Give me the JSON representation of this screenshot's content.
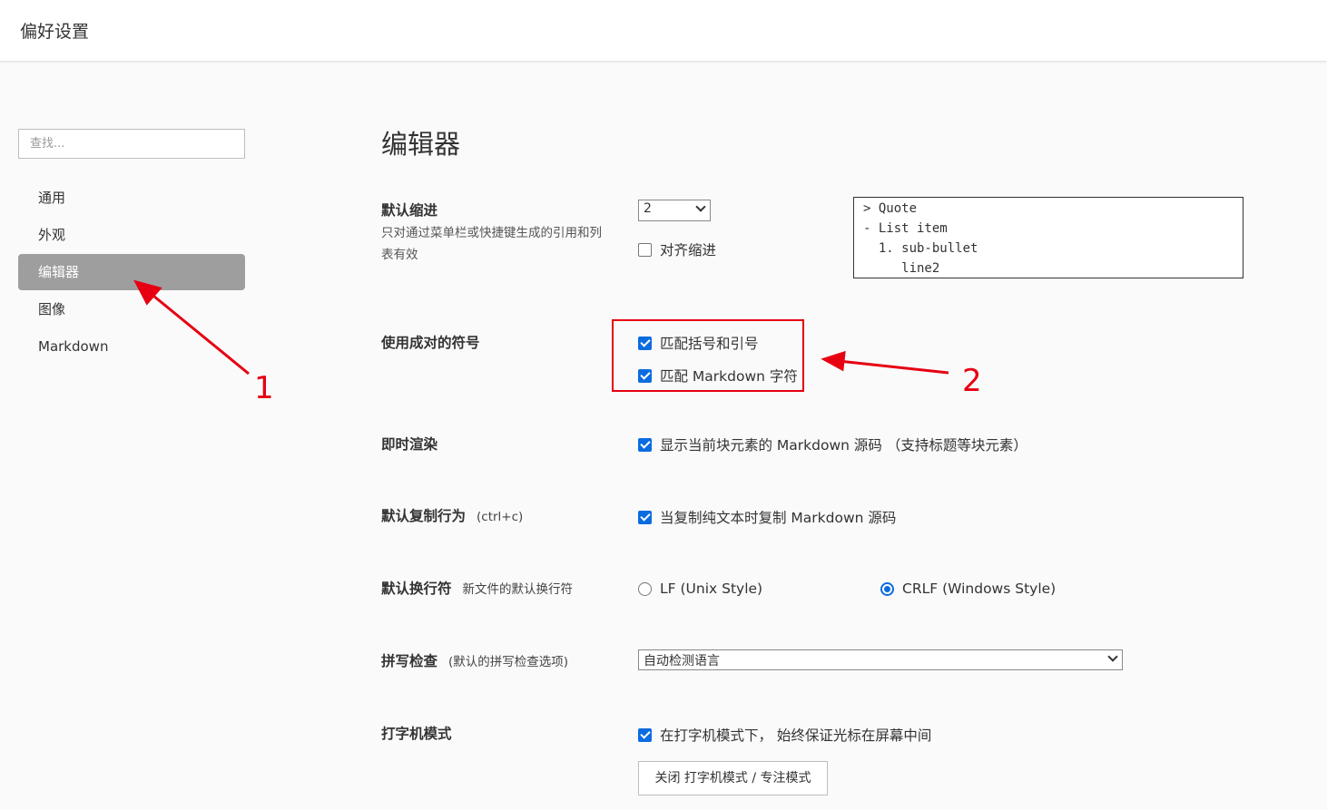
{
  "header": {
    "title": "偏好设置"
  },
  "sidebar": {
    "search_placeholder": "查找...",
    "items": [
      {
        "label": "通用",
        "active": false
      },
      {
        "label": "外观",
        "active": false
      },
      {
        "label": "编辑器",
        "active": true
      },
      {
        "label": "图像",
        "active": false
      },
      {
        "label": "Markdown",
        "active": false
      }
    ]
  },
  "main": {
    "title": "编辑器",
    "indent": {
      "label": "默认缩进",
      "desc": "只对通过菜单栏或快捷键生成的引用和列表有效",
      "value": "2",
      "align_label": "对齐缩进",
      "align_checked": false,
      "preview": "> Quote\n- List item\n  1. sub-bullet\n     line2"
    },
    "pairs": {
      "label": "使用成对的符号",
      "options": [
        {
          "label": "匹配括号和引号",
          "checked": true
        },
        {
          "label": "匹配 Markdown 字符",
          "checked": true
        }
      ]
    },
    "instant_render": {
      "label": "即时渲染",
      "option": "显示当前块元素的 Markdown 源码 （支持标题等块元素）",
      "checked": true
    },
    "copy": {
      "label": "默认复制行为",
      "sub": "(ctrl+c)",
      "option": "当复制纯文本时复制 Markdown 源码",
      "checked": true
    },
    "line_ending": {
      "label": "默认换行符",
      "sub": "新文件的默认换行符",
      "options": [
        {
          "label": "LF (Unix Style)",
          "selected": false
        },
        {
          "label": "CRLF (Windows Style)",
          "selected": true
        }
      ]
    },
    "spell": {
      "label": "拼写检查",
      "sub": "(默认的拼写检查选项)",
      "value": "自动检测语言"
    },
    "typewriter": {
      "label": "打字机模式",
      "option": "在打字机模式下， 始终保证光标在屏幕中间",
      "checked": true,
      "button": "关闭 打字机模式 / 专注模式"
    }
  },
  "annotations": {
    "one": "1",
    "two": "2",
    "color": "#e60012"
  },
  "colors": {
    "accent": "#0b6ce0",
    "active_nav": "#9e9e9e"
  }
}
